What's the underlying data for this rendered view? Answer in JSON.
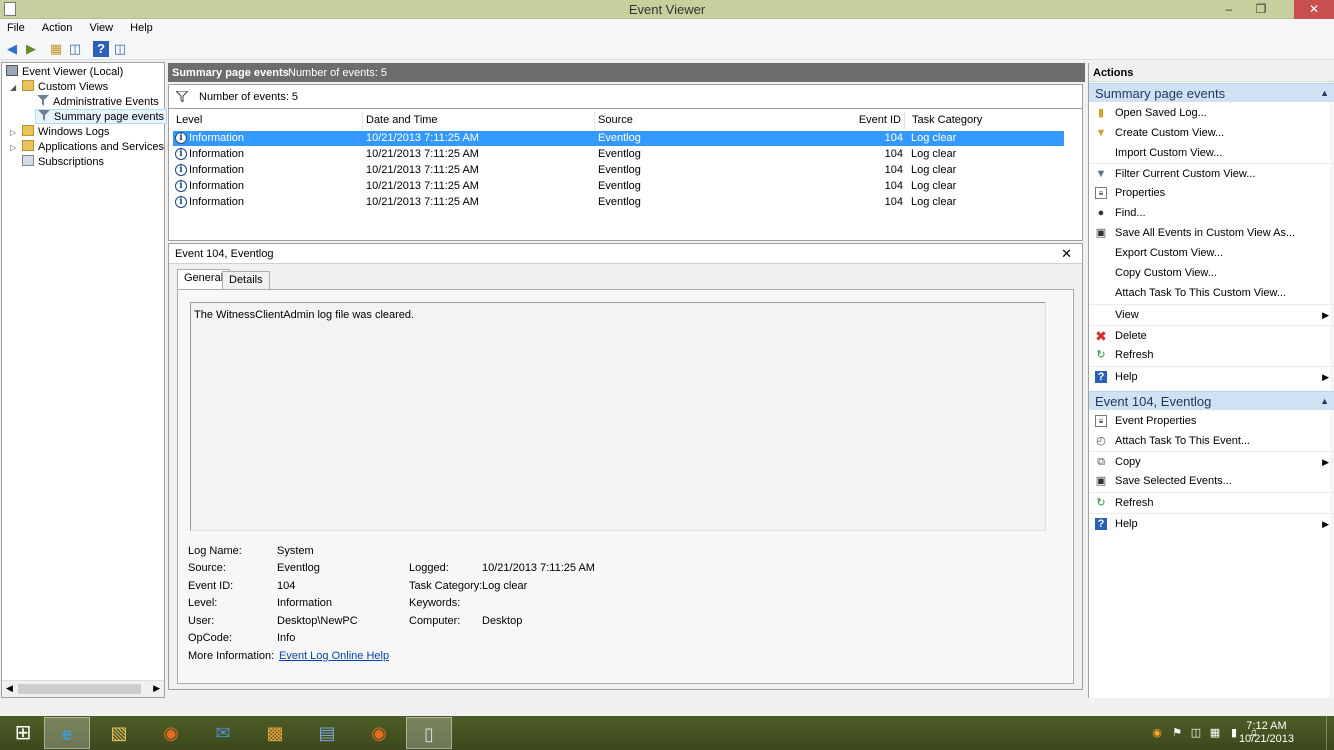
{
  "window": {
    "title": "Event Viewer"
  },
  "menu": [
    "File",
    "Action",
    "View",
    "Help"
  ],
  "tree": {
    "items": [
      {
        "label": "Event Viewer (Local)"
      },
      {
        "label": "Custom Views"
      },
      {
        "label": "Administrative Events"
      },
      {
        "label": "Summary page events"
      },
      {
        "label": "Windows Logs"
      },
      {
        "label": "Applications and Services Lo"
      },
      {
        "label": "Subscriptions"
      }
    ]
  },
  "summary": {
    "title": "Summary page events",
    "count_label": "Number of events: 5",
    "filter_label": "Number of events: 5"
  },
  "columns": {
    "level": "Level",
    "datetime": "Date and Time",
    "source": "Source",
    "event_id": "Event ID",
    "task_category": "Task Category"
  },
  "events": [
    {
      "level": "Information",
      "datetime": "10/21/2013 7:11:25 AM",
      "source": "Eventlog",
      "event_id": "104",
      "task_category": "Log clear"
    },
    {
      "level": "Information",
      "datetime": "10/21/2013 7:11:25 AM",
      "source": "Eventlog",
      "event_id": "104",
      "task_category": "Log clear"
    },
    {
      "level": "Information",
      "datetime": "10/21/2013 7:11:25 AM",
      "source": "Eventlog",
      "event_id": "104",
      "task_category": "Log clear"
    },
    {
      "level": "Information",
      "datetime": "10/21/2013 7:11:25 AM",
      "source": "Eventlog",
      "event_id": "104",
      "task_category": "Log clear"
    },
    {
      "level": "Information",
      "datetime": "10/21/2013 7:11:25 AM",
      "source": "Eventlog",
      "event_id": "104",
      "task_category": "Log clear"
    }
  ],
  "detail": {
    "title": "Event 104, Eventlog",
    "tabs": [
      "General",
      "Details"
    ],
    "description": "The WitnessClientAdmin log file was cleared.",
    "fields": {
      "log_name_label": "Log Name:",
      "log_name": "System",
      "source_label": "Source:",
      "source": "Eventlog",
      "event_id_label": "Event ID:",
      "event_id": "104",
      "level_label": "Level:",
      "level": "Information",
      "user_label": "User:",
      "user": "Desktop\\NewPC",
      "opcode_label": "OpCode:",
      "opcode": "Info",
      "more_info_label": "More Information:",
      "more_info_link": "Event Log Online Help",
      "logged_label": "Logged:",
      "logged": "10/21/2013 7:11:25 AM",
      "task_category_label": "Task Category:",
      "task_category": "Log clear",
      "keywords_label": "Keywords:",
      "keywords": "",
      "computer_label": "Computer:",
      "computer": "Desktop"
    }
  },
  "actions": {
    "header": "Actions",
    "group1_title": "Summary page events",
    "group1_items": [
      "Open Saved Log...",
      "Create Custom View...",
      "Import Custom View...",
      "Filter Current Custom View...",
      "Properties",
      "Find...",
      "Save All Events in Custom View As...",
      "Export Custom View...",
      "Copy Custom View...",
      "Attach Task To This Custom View...",
      "View",
      "Delete",
      "Refresh",
      "Help"
    ],
    "group2_title": "Event 104, Eventlog",
    "group2_items": [
      "Event Properties",
      "Attach Task To This Event...",
      "Copy",
      "Save Selected Events...",
      "Refresh",
      "Help"
    ]
  },
  "taskbar": {
    "time": "7:12 AM",
    "date": "10/21/2013"
  }
}
